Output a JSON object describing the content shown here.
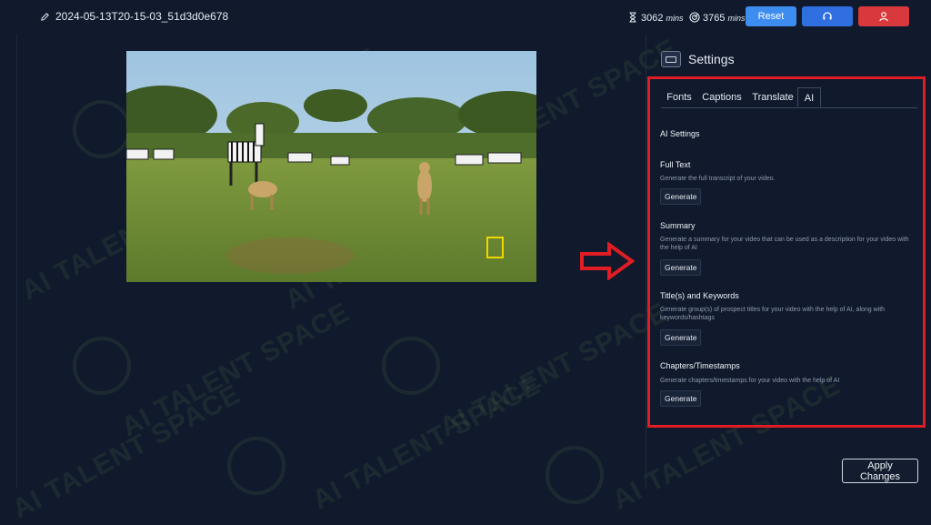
{
  "header": {
    "project_name": "2024-05-13T20-15-03_51d3d0e678",
    "stat1_value": "3062",
    "stat1_unit": "mins",
    "stat2_value": "3765",
    "stat2_unit": "mins",
    "reset_label": "Reset"
  },
  "settings": {
    "title": "Settings",
    "tabs": [
      "Fonts",
      "Captions",
      "Translate",
      "AI"
    ],
    "active_tab": "AI",
    "ai_heading": "AI Settings",
    "sections": [
      {
        "title": "Full Text",
        "description": "Generate the full transcript of your video.",
        "button": "Generate"
      },
      {
        "title": "Summary",
        "description": "Generate a summary for your video that can be used as a description for your video with the help of AI",
        "button": "Generate"
      },
      {
        "title": "Title(s) and Keywords",
        "description": "Generate group(s) of prospect titles for your video with the help of AI, along with keywords/hashtags",
        "button": "Generate"
      },
      {
        "title": "Chapters/Timestamps",
        "description": "Generate chapters/timestamps for your video with the help of AI",
        "button": "Generate"
      }
    ]
  },
  "footer": {
    "apply_label": "Apply Changes"
  },
  "watermark": {
    "text": "AI TALENT SPACE"
  },
  "colors": {
    "background": "#111a2c",
    "accent": "#3d8cf0",
    "danger": "#d9383d",
    "highlight": "#e01d25"
  }
}
